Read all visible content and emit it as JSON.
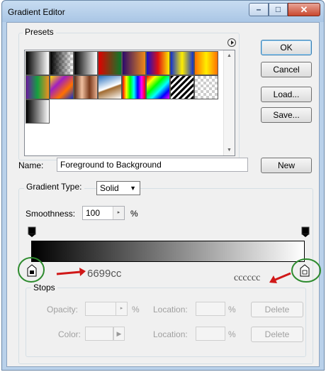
{
  "window": {
    "title": "Gradient Editor",
    "controls": {
      "minimize": "–",
      "maximize": "□",
      "close": "✕"
    }
  },
  "presets": {
    "legend": "Presets",
    "menu_icon": "flyout-menu-icon",
    "swatches": [
      {
        "name": "foreground-to-background",
        "css": "linear-gradient(to right,#000,#fff)"
      },
      {
        "name": "foreground-to-transparent",
        "css": "linear-gradient(to right,#000,rgba(0,0,0,0)),repeating-conic-gradient(#ccc 0 25%,#fff 0 50%) 0 0/8px 8px"
      },
      {
        "name": "black-white",
        "css": "linear-gradient(to right,#000,#fff)"
      },
      {
        "name": "red-green",
        "css": "linear-gradient(to right,#e00000,#0a7a2a)"
      },
      {
        "name": "violet-orange",
        "css": "linear-gradient(to right,#2b0a6b,#f08a18)"
      },
      {
        "name": "blue-red-yellow",
        "css": "linear-gradient(to right,#1010d0,#e01010,#ffee00)"
      },
      {
        "name": "blue-yellow-blue",
        "css": "linear-gradient(to right,#1030d0,#ffee00,#1030d0)"
      },
      {
        "name": "orange-yellow-orange",
        "css": "linear-gradient(to right,#ff7000,#ffee00,#ff7000)"
      },
      {
        "name": "violet-green-orange",
        "css": "linear-gradient(to right,#6a1aa0,#14a040,#f09020)"
      },
      {
        "name": "yellow-violet-orange-blue",
        "css": "linear-gradient(135deg,#ffe000,#a020c0,#ff7000,#1030d0)"
      },
      {
        "name": "copper",
        "css": "linear-gradient(to right,#5a2a14,#f0c0a0,#7a3a1c,#e8b090)"
      },
      {
        "name": "chrome",
        "css": "linear-gradient(160deg,#2870c0,#fff 50%,#a06a30 55%,#fff)"
      },
      {
        "name": "spectrum",
        "css": "linear-gradient(to right,#f00,#ff0,#0f0,#0ff,#00f,#f0f,#f00)"
      },
      {
        "name": "transparent-rainbow",
        "css": "linear-gradient(135deg,#f00,#ff0,#0f0,#0ff,#00f,#f0f)"
      },
      {
        "name": "transparent-stripes",
        "css": "repeating-linear-gradient(135deg,#000 0 3px,#fff 3px 6px)"
      },
      {
        "name": "neutral-density",
        "css": "repeating-conic-gradient(#ccc 0 25%,#fff 0 50%) 0 0/8px 8px"
      },
      {
        "name": "black-to-white",
        "css": "linear-gradient(to right,#000,#fff)"
      }
    ]
  },
  "buttons": {
    "ok": "OK",
    "cancel": "Cancel",
    "load": "Load...",
    "save": "Save...",
    "new": "New"
  },
  "name_field": {
    "label": "Name:",
    "value": "Foreground to Background"
  },
  "gradient": {
    "type_label": "Gradient Type:",
    "type_value": "Solid",
    "smoothness_label": "Smoothness:",
    "smoothness_value": "100",
    "smoothness_unit": "%",
    "start_color": "#000000",
    "end_color": "#ffffff"
  },
  "annotations": {
    "left_color": "6699cc",
    "right_color": "cccccc"
  },
  "stops": {
    "legend": "Stops",
    "opacity_label": "Opacity:",
    "opacity_unit": "%",
    "location_label": "Location:",
    "location_unit": "%",
    "color_label": "Color:",
    "delete_label": "Delete"
  }
}
